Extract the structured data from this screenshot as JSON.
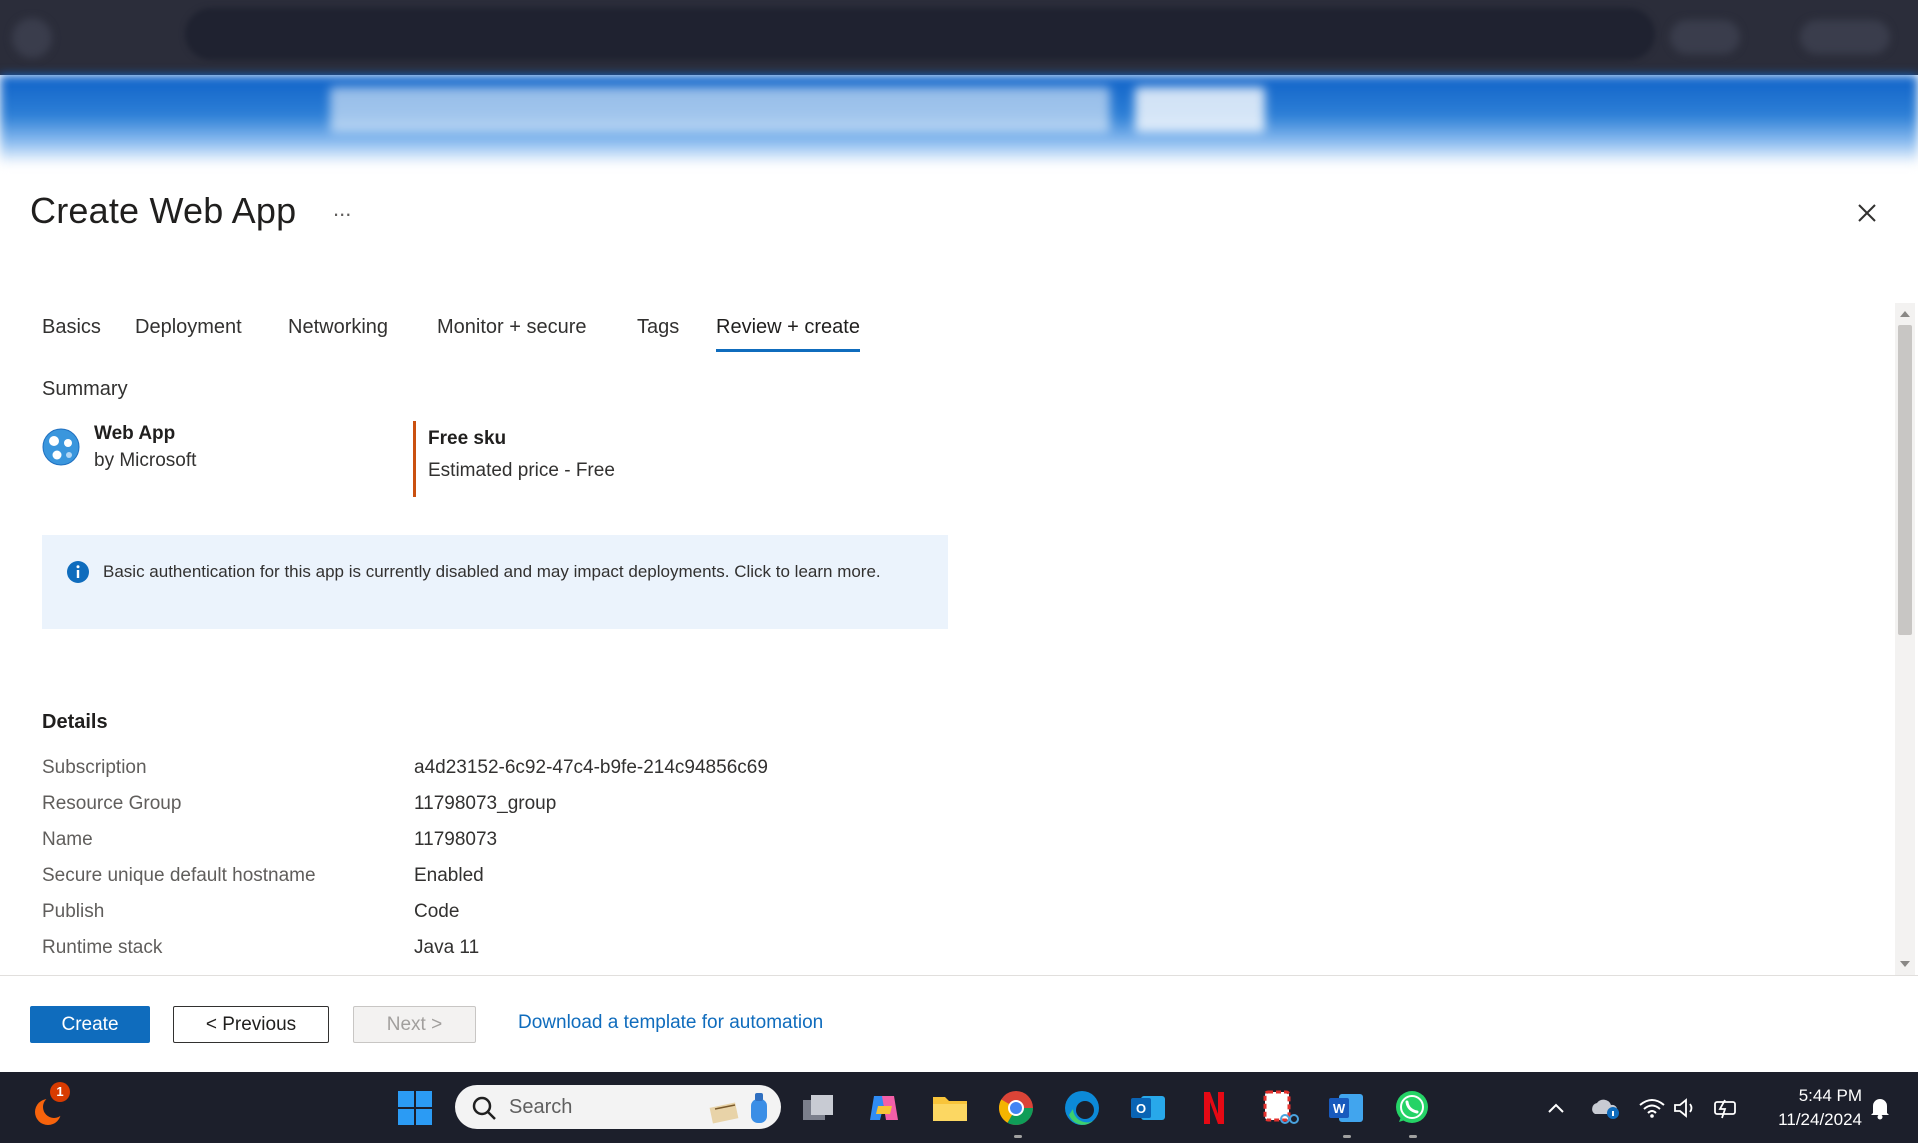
{
  "blade": {
    "title": "Create Web App",
    "more_label": "...",
    "close_icon": "close-icon"
  },
  "tabs": [
    {
      "label": "Basics"
    },
    {
      "label": "Deployment"
    },
    {
      "label": "Networking"
    },
    {
      "label": "Monitor + secure"
    },
    {
      "label": "Tags"
    },
    {
      "label": "Review + create",
      "active": true
    }
  ],
  "summary": {
    "heading": "Summary",
    "product_name": "Web App",
    "publisher": "by Microsoft",
    "sku_name": "Free sku",
    "sku_price": "Estimated price - Free"
  },
  "info_banner": {
    "icon": "info-icon",
    "text": "Basic authentication for this app is currently disabled and may impact deployments. Click to learn more."
  },
  "details": {
    "heading": "Details",
    "rows": [
      {
        "label": "Subscription",
        "value": "a4d23152-6c92-47c4-b9fe-214c94856c69"
      },
      {
        "label": "Resource Group",
        "value": "11798073_group"
      },
      {
        "label": "Name",
        "value": "11798073"
      },
      {
        "label": "Secure unique default hostname",
        "value": "Enabled"
      },
      {
        "label": "Publish",
        "value": "Code"
      },
      {
        "label": "Runtime stack",
        "value": "Java 11"
      }
    ]
  },
  "footer": {
    "create_label": "Create",
    "previous_label": "< Previous",
    "next_label": "Next >",
    "download_link": "Download a template for automation"
  },
  "taskbar": {
    "search_placeholder": "Search",
    "notification_badge": "1",
    "time": "5:44 PM",
    "date": "11/24/2024"
  },
  "colors": {
    "accent": "#0f6cbd",
    "sku_bar": "#ca5010",
    "info_bg": "#ebf3fc",
    "taskbar_bg": "#1c1f2b"
  }
}
